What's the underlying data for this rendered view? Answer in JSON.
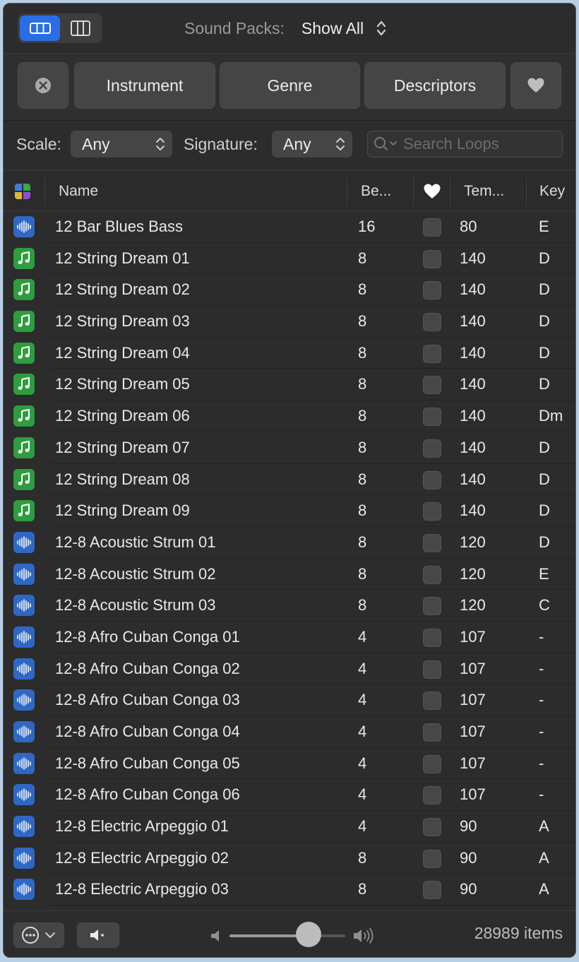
{
  "toolbar": {
    "sound_packs_label": "Sound Packs:",
    "sound_packs_value": "Show All"
  },
  "filters": {
    "instrument": "Instrument",
    "genre": "Genre",
    "descriptors": "Descriptors"
  },
  "search": {
    "scale_label": "Scale:",
    "scale_value": "Any",
    "signature_label": "Signature:",
    "signature_value": "Any",
    "placeholder": "Search Loops"
  },
  "columns": {
    "name": "Name",
    "beats": "Be...",
    "tempo": "Tem...",
    "key": "Key"
  },
  "rows": [
    {
      "type": "audio",
      "name": "12 Bar Blues Bass",
      "beats": "16",
      "tempo": "80",
      "key": "E"
    },
    {
      "type": "midi",
      "name": "12 String Dream 01",
      "beats": "8",
      "tempo": "140",
      "key": "D"
    },
    {
      "type": "midi",
      "name": "12 String Dream 02",
      "beats": "8",
      "tempo": "140",
      "key": "D"
    },
    {
      "type": "midi",
      "name": "12 String Dream 03",
      "beats": "8",
      "tempo": "140",
      "key": "D"
    },
    {
      "type": "midi",
      "name": "12 String Dream 04",
      "beats": "8",
      "tempo": "140",
      "key": "D"
    },
    {
      "type": "midi",
      "name": "12 String Dream 05",
      "beats": "8",
      "tempo": "140",
      "key": "D"
    },
    {
      "type": "midi",
      "name": "12 String Dream 06",
      "beats": "8",
      "tempo": "140",
      "key": "Dm"
    },
    {
      "type": "midi",
      "name": "12 String Dream 07",
      "beats": "8",
      "tempo": "140",
      "key": "D"
    },
    {
      "type": "midi",
      "name": "12 String Dream 08",
      "beats": "8",
      "tempo": "140",
      "key": "D"
    },
    {
      "type": "midi",
      "name": "12 String Dream 09",
      "beats": "8",
      "tempo": "140",
      "key": "D"
    },
    {
      "type": "audio",
      "name": "12-8 Acoustic Strum 01",
      "beats": "8",
      "tempo": "120",
      "key": "D"
    },
    {
      "type": "audio",
      "name": "12-8 Acoustic Strum 02",
      "beats": "8",
      "tempo": "120",
      "key": "E"
    },
    {
      "type": "audio",
      "name": "12-8 Acoustic Strum 03",
      "beats": "8",
      "tempo": "120",
      "key": "C"
    },
    {
      "type": "audio",
      "name": "12-8 Afro Cuban Conga 01",
      "beats": "4",
      "tempo": "107",
      "key": "-"
    },
    {
      "type": "audio",
      "name": "12-8 Afro Cuban Conga 02",
      "beats": "4",
      "tempo": "107",
      "key": "-"
    },
    {
      "type": "audio",
      "name": "12-8 Afro Cuban Conga 03",
      "beats": "4",
      "tempo": "107",
      "key": "-"
    },
    {
      "type": "audio",
      "name": "12-8 Afro Cuban Conga 04",
      "beats": "4",
      "tempo": "107",
      "key": "-"
    },
    {
      "type": "audio",
      "name": "12-8 Afro Cuban Conga 05",
      "beats": "4",
      "tempo": "107",
      "key": "-"
    },
    {
      "type": "audio",
      "name": "12-8 Afro Cuban Conga 06",
      "beats": "4",
      "tempo": "107",
      "key": "-"
    },
    {
      "type": "audio",
      "name": "12-8 Electric Arpeggio 01",
      "beats": "4",
      "tempo": "90",
      "key": "A"
    },
    {
      "type": "audio",
      "name": "12-8 Electric Arpeggio 02",
      "beats": "8",
      "tempo": "90",
      "key": "A"
    },
    {
      "type": "audio",
      "name": "12-8 Electric Arpeggio 03",
      "beats": "8",
      "tempo": "90",
      "key": "A"
    }
  ],
  "footer": {
    "item_count": "28989 items",
    "volume_level": 0.68
  },
  "colors": {
    "accent": "#2a6ee6",
    "audio_icon": "#2f68c4",
    "midi_icon": "#2e9d3f"
  },
  "icons": {
    "audio": "waveform-icon",
    "midi": "music-note-icon"
  }
}
